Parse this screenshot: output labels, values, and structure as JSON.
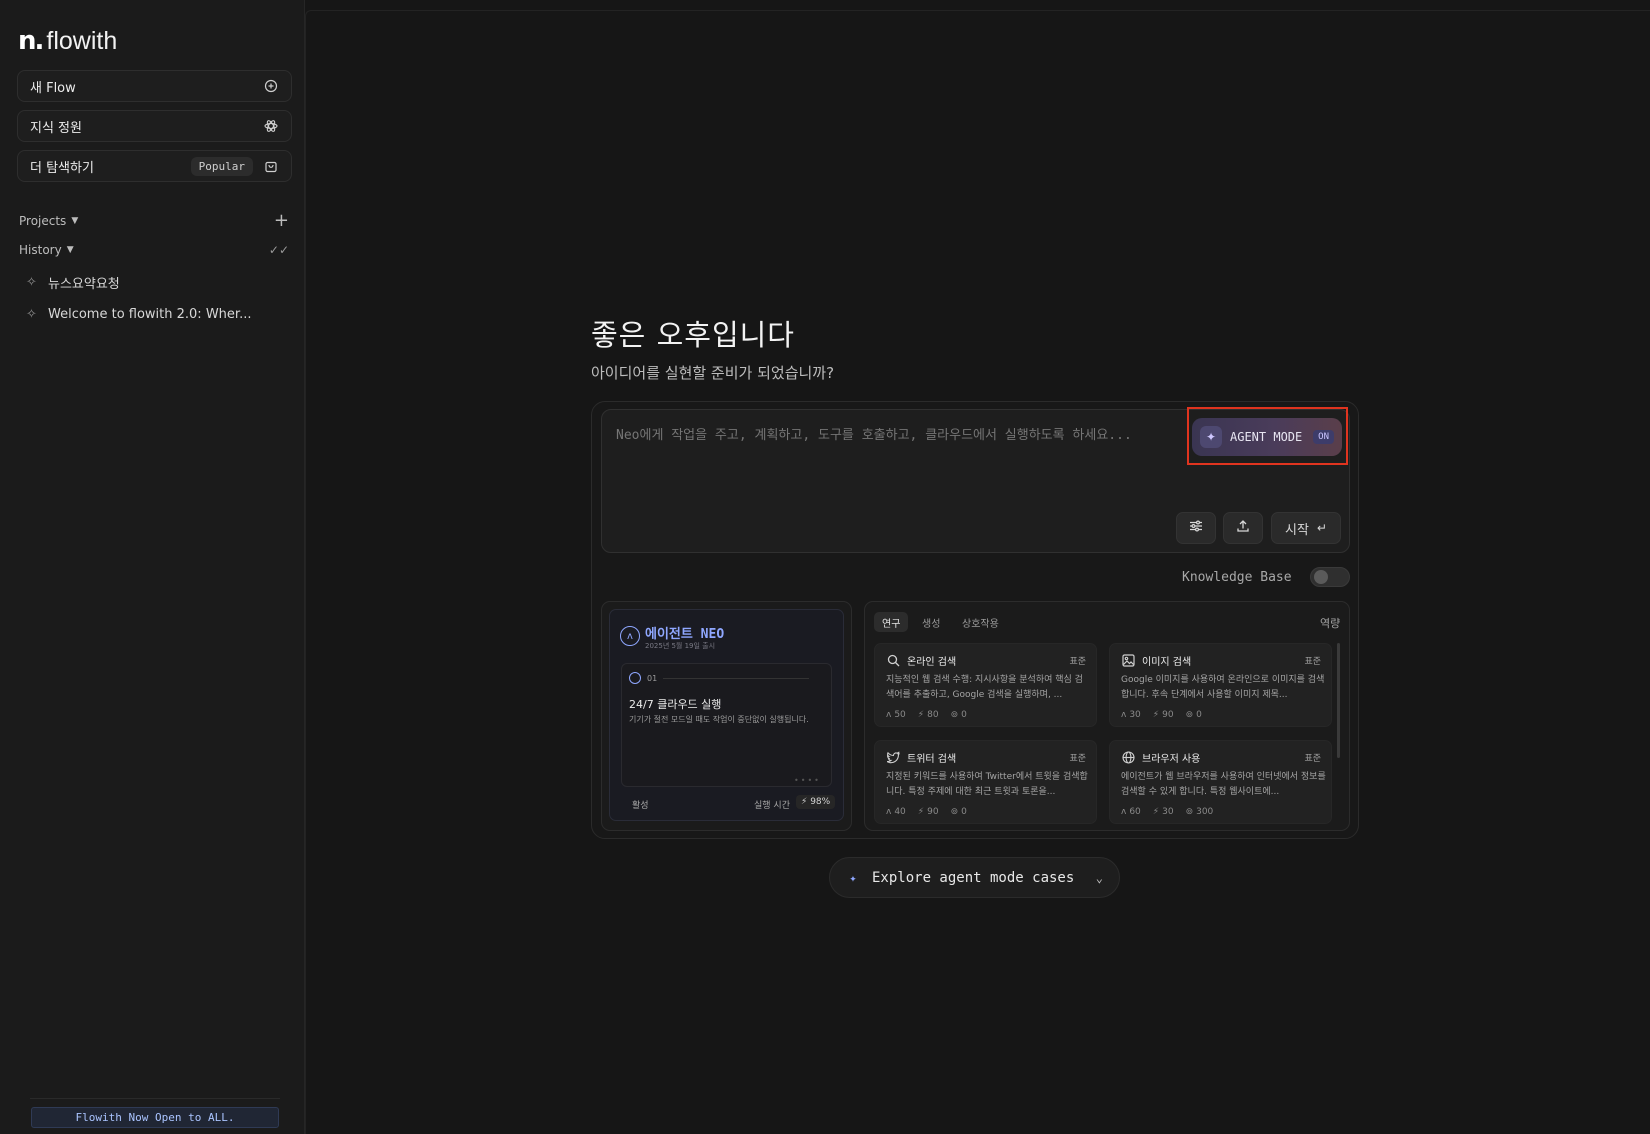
{
  "sidebar": {
    "logo_mark": "n.",
    "logo_text": "flowith",
    "new_flow": "새 Flow",
    "knowledge": "지식 정원",
    "explore_more": "더 탐색하기",
    "popular_badge": "Popular",
    "projects": "Projects",
    "history": "History",
    "history_items": [
      "뉴스요약요청",
      "Welcome to flowith 2.0: Wher..."
    ],
    "announcement": "Flowith Now Open to ALL."
  },
  "main": {
    "greeting": "좋은 오후입니다",
    "subgreeting": "아이디어를 실현할 준비가 되었습니까?",
    "prompt_placeholder": "Neo에게 작업을 주고, 계획하고, 도구를 호출하고, 클라우드에서 실행하도록 하세요...",
    "agent_mode_label": "AGENT MODE",
    "agent_mode_state": "ON",
    "start_label": "시작",
    "knowledge_base_label": "Knowledge Base",
    "knowledge_base_on": false
  },
  "agent_card": {
    "title": "에이전트 NEO",
    "date": "2025년 5월 19일 출시",
    "step": "01",
    "feature_title": "24/7 클라우드 실행",
    "feature_desc": "기기가 절전 모드일 때도 작업이 중단없이 실행됩니다.",
    "status": "활성",
    "runtime_label": "실행 시간",
    "runtime_value": "98%"
  },
  "capabilities": {
    "tabs": [
      "연구",
      "생성",
      "상호작용"
    ],
    "active_tab": "연구",
    "right_label": "역량",
    "cards": [
      {
        "title": "온라인 검색",
        "tier": "표준",
        "desc": "지능적인 웹 검색 수행: 지시사항을 분석하여 핵심 검색어를 추출하고, Google 검색을 실행하며, ...",
        "stats": [
          "50",
          "80",
          "0"
        ],
        "icon": "search-icon"
      },
      {
        "title": "이미지 검색",
        "tier": "표준",
        "desc": "Google 이미지를 사용하여 온라인으로 이미지를 검색합니다. 후속 단계에서 사용할 이미지 제목...",
        "stats": [
          "30",
          "90",
          "0"
        ],
        "icon": "image-icon"
      },
      {
        "title": "트위터 검색",
        "tier": "표준",
        "desc": "지정된 키워드를 사용하여 Twitter에서 트윗을 검색합니다. 특정 주제에 대한 최근 트윗과 토론을...",
        "stats": [
          "40",
          "90",
          "0"
        ],
        "icon": "twitter-icon"
      },
      {
        "title": "브라우저 사용",
        "tier": "표준",
        "desc": "에이전트가 웹 브라우저를 사용하여 인터넷에서 정보를 검색할 수 있게 합니다. 특정 웹사이트에...",
        "stats": [
          "60",
          "30",
          "300"
        ],
        "icon": "globe-icon"
      }
    ]
  },
  "explore_button": "Explore agent mode cases",
  "colors": {
    "accent": "#8fa7ff",
    "highlight": "#e0341f",
    "background": "#161616"
  }
}
